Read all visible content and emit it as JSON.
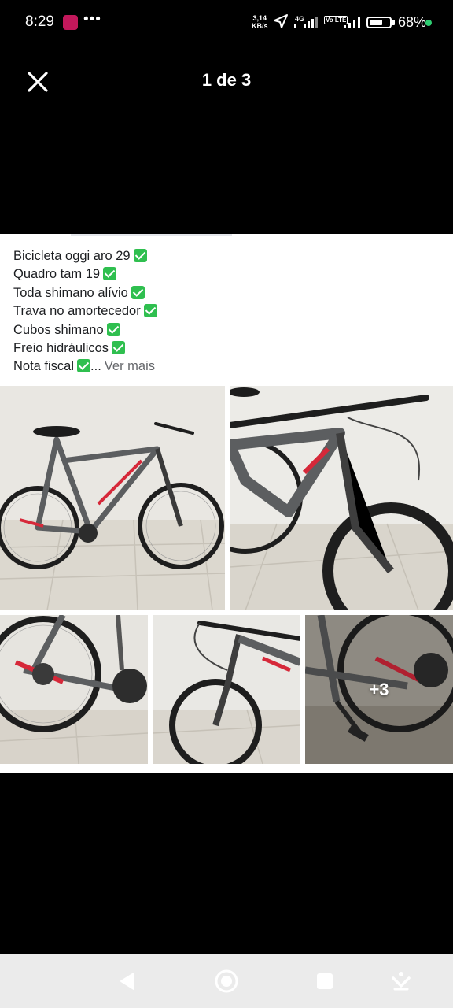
{
  "status": {
    "time": "8:29",
    "speed_value": "3,14",
    "speed_unit": "KB/s",
    "network": "4G",
    "volte": "Vo LTE",
    "battery": "68%",
    "battery_level": 0.68,
    "dots": "•••"
  },
  "viewer": {
    "counter": "1 de 3"
  },
  "post": {
    "lines": [
      "Bicicleta oggi aro 29",
      "Quadro tam 19",
      "Toda shimano alívio",
      "Trava no amortecedor",
      "Cubos shimano",
      "Freio hidráulicos",
      "Nota fiscal"
    ],
    "ellipsis": "...",
    "see_more": "Ver mais",
    "more_photos": "+3"
  },
  "colors": {
    "check": "#2fbf4f",
    "frame": "#5c5e60",
    "accent": "#d62839"
  },
  "icons": {
    "close": "close-icon",
    "back": "back-icon",
    "home": "home-icon",
    "recents": "recents-icon",
    "assist": "assist-icon"
  }
}
